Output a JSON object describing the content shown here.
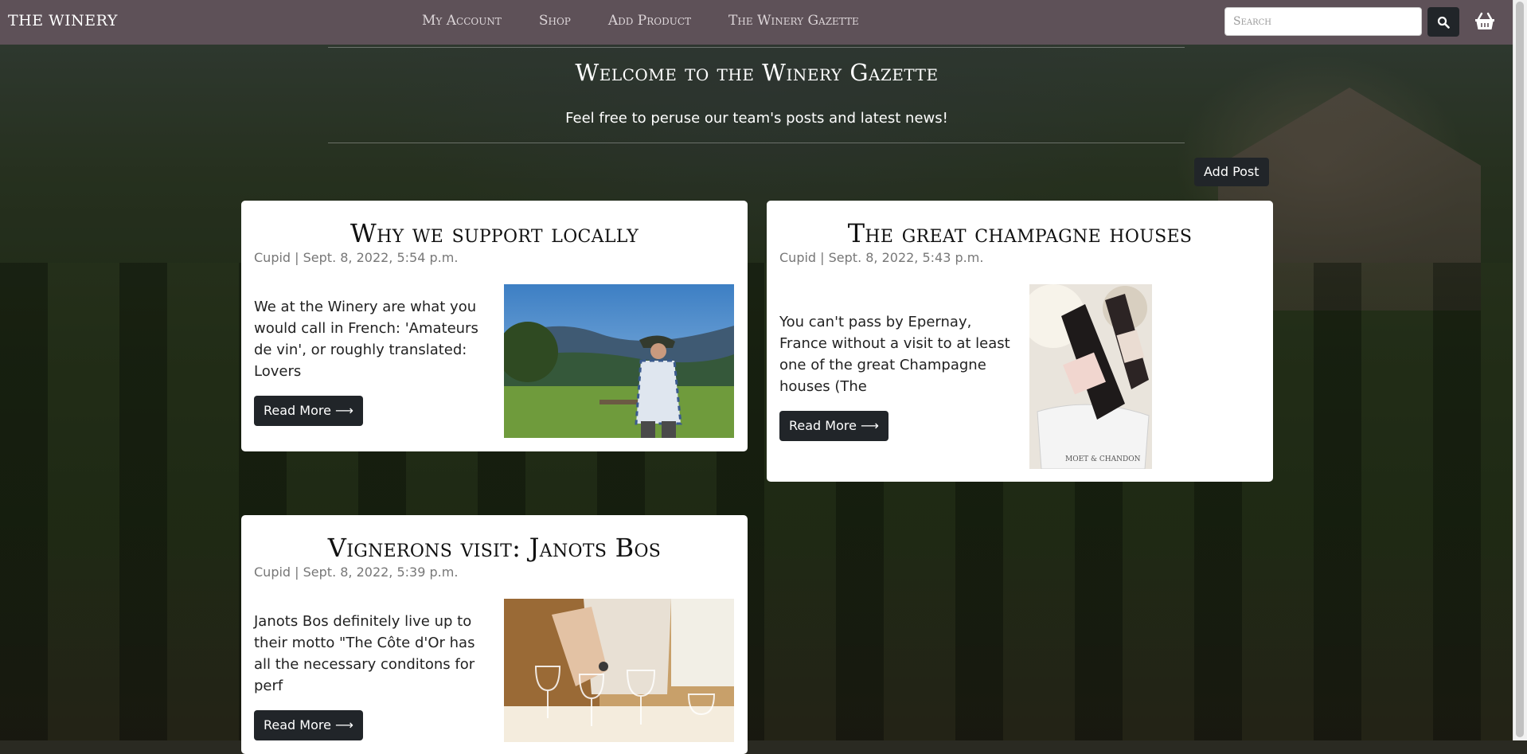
{
  "navbar": {
    "brand": "THE WINERY",
    "links": [
      "My Account",
      "Shop",
      "Add Product",
      "The Winery Gazette"
    ],
    "search_placeholder": "Search"
  },
  "header": {
    "title": "Welcome to the Winery Gazette",
    "subtitle": "Feel free to peruse our team's posts and latest news!"
  },
  "actions": {
    "add_post": "Add Post"
  },
  "posts": [
    {
      "title": "Why we support locally",
      "meta": "Cupid | Sept. 8, 2022, 5:54 p.m.",
      "excerpt": "We at the Winery are what you would call in French: 'Amateurs de vin', or roughly translated: Lovers",
      "read_more": "Read More ⟶"
    },
    {
      "title": "The great champagne houses",
      "meta": "Cupid | Sept. 8, 2022, 5:43 p.m.",
      "excerpt": "You can't pass by Epernay, France without a visit to at least one of the great Champagne houses (The",
      "read_more": "Read More ⟶"
    },
    {
      "title": "Vignerons visit: Janots Bos",
      "meta": "Cupid | Sept. 8, 2022, 5:39 p.m.",
      "excerpt": "Janots Bos definitely live up to their motto \"The Côte d'Or has all the necessary conditons for perf",
      "read_more": "Read More ⟶"
    }
  ],
  "colors": {
    "navbar": "#5e5158",
    "button_dark": "#212529",
    "card": "#ffffff"
  },
  "icons": {
    "search": "search-icon",
    "cart": "basket-icon"
  }
}
